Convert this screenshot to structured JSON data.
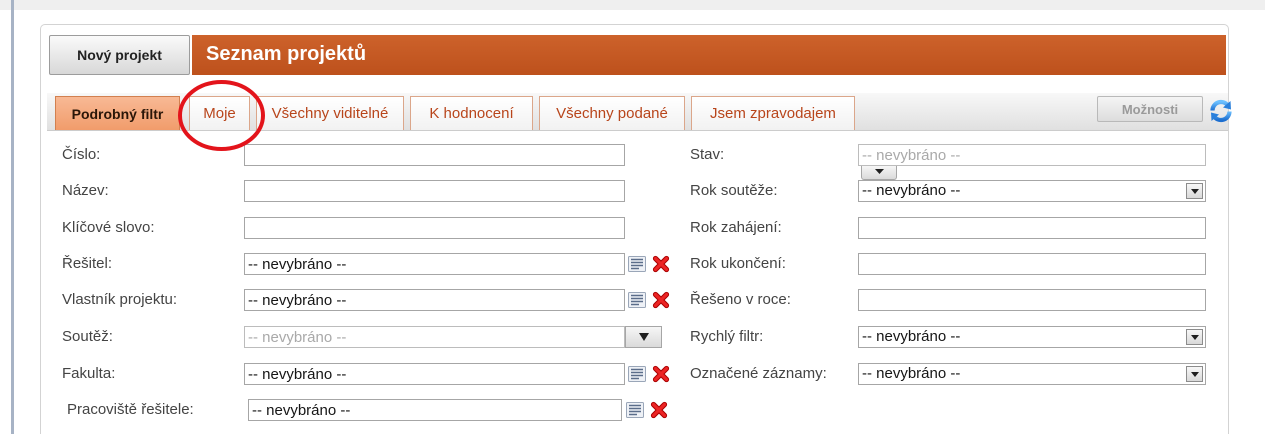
{
  "header": {
    "new_project_label": "Nový projekt",
    "title": "Seznam projektů"
  },
  "tabs": [
    {
      "label": "Podrobný filtr",
      "active": true
    },
    {
      "label": "Moje",
      "active": false
    },
    {
      "label": "Všechny viditelné",
      "active": false
    },
    {
      "label": "K hodnocení",
      "active": false
    },
    {
      "label": "Všechny podané",
      "active": false
    },
    {
      "label": "Jsem zpravodajem",
      "active": false
    }
  ],
  "toolbar": {
    "options_label": "Možnosti",
    "options_enabled": false
  },
  "filters": {
    "left": [
      {
        "label": "Číslo:",
        "value": ""
      },
      {
        "label": "Název:",
        "value": ""
      },
      {
        "label": "Klíčové slovo:",
        "value": ""
      },
      {
        "label": "Řešitel:",
        "value": "-- nevybráno --"
      },
      {
        "label": "Vlastník projektu:",
        "value": "-- nevybráno --"
      },
      {
        "label": "Soutěž:",
        "value": "-- nevybráno --",
        "disabled": true
      },
      {
        "label": "Fakulta:",
        "value": "-- nevybráno --"
      },
      {
        "label": "Pracoviště řešitele:",
        "value": "-- nevybráno --"
      }
    ],
    "right": [
      {
        "label": "Stav:",
        "value": "-- nevybráno --",
        "disabled": true
      },
      {
        "label": "Rok soutěže:",
        "value": "-- nevybráno --"
      },
      {
        "label": "Rok zahájení:",
        "value": ""
      },
      {
        "label": "Rok ukončení:",
        "value": ""
      },
      {
        "label": "Řešeno v roce:",
        "value": ""
      },
      {
        "label": "Rychlý filtr:",
        "value": "-- nevybráno --"
      },
      {
        "label": "Označené záznamy:",
        "value": "-- nevybráno --"
      }
    ]
  },
  "icons": {
    "lookup": "list-icon",
    "clear": "clear-icon",
    "dropdown": "chevron-down-icon",
    "refresh": "refresh-icon"
  },
  "colors": {
    "header_bar": "#c65a22",
    "active_tab": "#f4a77a",
    "tab_text": "#b8451b",
    "clear_icon": "#e32222",
    "annotation_circle": "#e3141b"
  }
}
